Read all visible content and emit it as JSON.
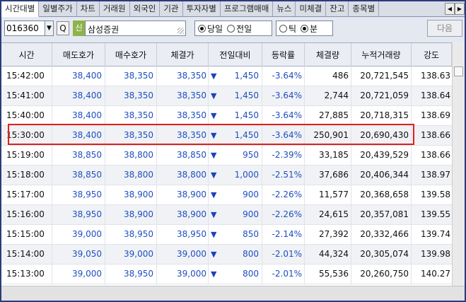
{
  "tabs": [
    {
      "label": "시간대별",
      "active": true
    },
    {
      "label": "일별주가",
      "active": false
    },
    {
      "label": "차트",
      "active": false
    },
    {
      "label": "거래원",
      "active": false
    },
    {
      "label": "외국인",
      "active": false
    },
    {
      "label": "기관",
      "active": false
    },
    {
      "label": "투자자별",
      "active": false
    },
    {
      "label": "프로그램매매",
      "active": false
    },
    {
      "label": "뉴스",
      "active": false
    },
    {
      "label": "미체결",
      "active": false
    },
    {
      "label": "잔고",
      "active": false
    },
    {
      "label": "종목별",
      "active": false
    }
  ],
  "tab_arrows": {
    "prev": "◀",
    "next": "▶"
  },
  "toolbar": {
    "stock_code": "016360",
    "dropdown_glyph": "▼",
    "search_glyph": "Q",
    "market_badge": "신",
    "stock_name": "삼성증권",
    "day_options": [
      {
        "label": "당일",
        "selected": true
      },
      {
        "label": "전일",
        "selected": false
      }
    ],
    "unit_options": [
      {
        "label": "틱",
        "selected": false
      },
      {
        "label": "분",
        "selected": true
      }
    ],
    "next_label": "다음"
  },
  "table": {
    "columns": [
      "시간",
      "매도호가",
      "매수호가",
      "체결가",
      "전일대비",
      "등락률",
      "체결량",
      "누적거래량",
      "강도"
    ],
    "highlighted_row": 3,
    "rows": [
      {
        "time": "15:42:00",
        "ask": "38,400",
        "bid": "38,350",
        "price": "38,350",
        "change": "1,450",
        "rate": "-3.64%",
        "volume": "486",
        "acc_volume": "20,721,545",
        "strength": "138.63"
      },
      {
        "time": "15:41:00",
        "ask": "38,400",
        "bid": "38,350",
        "price": "38,350",
        "change": "1,450",
        "rate": "-3.64%",
        "volume": "2,744",
        "acc_volume": "20,721,059",
        "strength": "138.64"
      },
      {
        "time": "15:40:00",
        "ask": "38,400",
        "bid": "38,350",
        "price": "38,350",
        "change": "1,450",
        "rate": "-3.64%",
        "volume": "27,885",
        "acc_volume": "20,718,315",
        "strength": "138.69"
      },
      {
        "time": "15:30:00",
        "ask": "38,400",
        "bid": "38,350",
        "price": "38,350",
        "change": "1,450",
        "rate": "-3.64%",
        "volume": "250,901",
        "acc_volume": "20,690,430",
        "strength": "138.66"
      },
      {
        "time": "15:19:00",
        "ask": "38,850",
        "bid": "38,800",
        "price": "38,850",
        "change": "950",
        "rate": "-2.39%",
        "volume": "33,185",
        "acc_volume": "20,439,529",
        "strength": "138.66"
      },
      {
        "time": "15:18:00",
        "ask": "38,850",
        "bid": "38,800",
        "price": "38,800",
        "change": "1,000",
        "rate": "-2.51%",
        "volume": "37,686",
        "acc_volume": "20,406,344",
        "strength": "138.97"
      },
      {
        "time": "15:17:00",
        "ask": "38,950",
        "bid": "38,900",
        "price": "38,900",
        "change": "900",
        "rate": "-2.26%",
        "volume": "11,577",
        "acc_volume": "20,368,658",
        "strength": "139.58"
      },
      {
        "time": "15:16:00",
        "ask": "38,950",
        "bid": "38,900",
        "price": "38,900",
        "change": "900",
        "rate": "-2.26%",
        "volume": "24,615",
        "acc_volume": "20,357,081",
        "strength": "139.55"
      },
      {
        "time": "15:15:00",
        "ask": "39,000",
        "bid": "38,950",
        "price": "38,950",
        "change": "850",
        "rate": "-2.14%",
        "volume": "27,392",
        "acc_volume": "20,332,466",
        "strength": "139.74"
      },
      {
        "time": "15:14:00",
        "ask": "39,050",
        "bid": "39,000",
        "price": "39,000",
        "change": "800",
        "rate": "-2.01%",
        "volume": "44,324",
        "acc_volume": "20,305,074",
        "strength": "139.98"
      },
      {
        "time": "15:13:00",
        "ask": "39,000",
        "bid": "38,950",
        "price": "39,000",
        "change": "800",
        "rate": "-2.01%",
        "volume": "55,536",
        "acc_volume": "20,260,750",
        "strength": "140.27"
      }
    ],
    "down_arrow": "▼"
  },
  "colors": {
    "price_blue": "#1e4fbf",
    "highlight_border": "#e0201b",
    "badge_green": "#8db34a"
  }
}
